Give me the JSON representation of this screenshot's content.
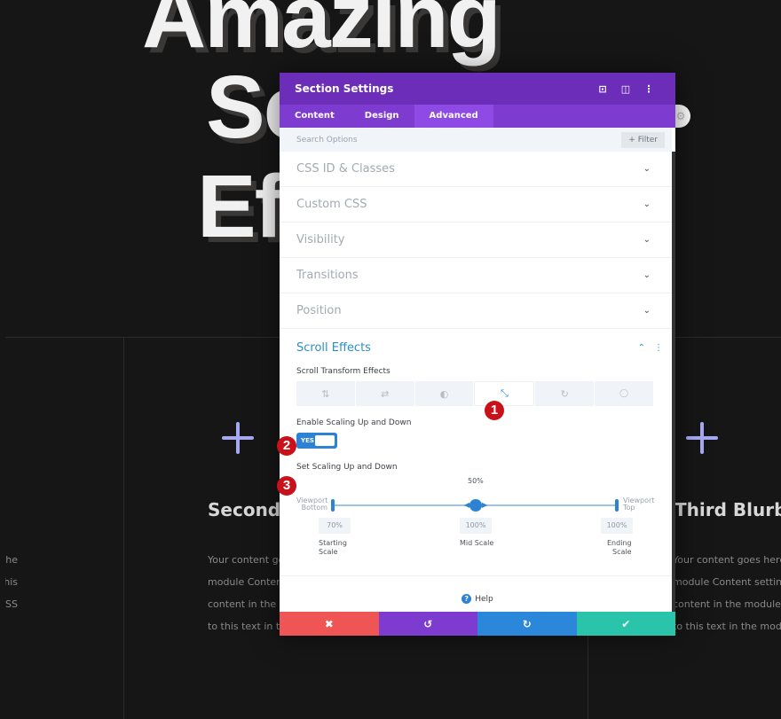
{
  "background": {
    "heading_lines": [
      "Amazing",
      "Sc",
      "Ef"
    ],
    "blurbs": [
      {
        "title": "",
        "text": [
          "the",
          "f this",
          "om CSS"
        ]
      },
      {
        "title": "Second",
        "text": [
          "Your content goe",
          "module Content",
          "content in the m",
          "to this text in the"
        ]
      },
      {
        "title": "Third Blurb",
        "text": [
          "Your content goes here. E",
          "module Content settings",
          "content in the module De",
          "to this text in the module"
        ]
      }
    ],
    "blurb_icon": "plus-icon",
    "accent": "#a7a8f2"
  },
  "modal": {
    "title": "Section Settings",
    "header_icons": [
      "focus-icon",
      "split-view-icon",
      "more-vertical-icon"
    ],
    "tabs": [
      {
        "label": "Content"
      },
      {
        "label": "Design"
      },
      {
        "label": "Advanced",
        "active": true
      }
    ],
    "search_placeholder": "Search Options",
    "filter_label": "+ Filter",
    "sections": [
      {
        "label": "CSS ID & Classes"
      },
      {
        "label": "Custom CSS"
      },
      {
        "label": "Visibility"
      },
      {
        "label": "Transitions"
      },
      {
        "label": "Position"
      }
    ],
    "scroll_effects": {
      "title": "Scroll Effects",
      "transform_label": "Scroll Transform Effects",
      "effects": [
        {
          "icon": "vertical-motion-icon",
          "glyph": "⇅"
        },
        {
          "icon": "horizontal-motion-icon",
          "glyph": "⇄"
        },
        {
          "icon": "fade-icon",
          "glyph": "◐"
        },
        {
          "icon": "scale-icon",
          "glyph": "⤡",
          "active": true
        },
        {
          "icon": "rotate-icon",
          "glyph": "↻"
        },
        {
          "icon": "blur-icon",
          "glyph": "💧"
        }
      ],
      "enable_label": "Enable Scaling Up and Down",
      "toggle_value": "YES",
      "set_label": "Set Scaling Up and Down",
      "slider": {
        "mid_percent": "50%",
        "left_label": [
          "Viewport",
          "Bottom"
        ],
        "right_label": [
          "Viewport",
          "Top"
        ],
        "starting_scale": "70%",
        "mid_scale": "100%",
        "ending_scale": "100%",
        "starting_caption": [
          "Starting",
          "Scale"
        ],
        "mid_caption": "Mid Scale",
        "ending_caption": [
          "Ending",
          "Scale"
        ]
      }
    },
    "help_label": "Help",
    "footer": {
      "cancel_color": "#ef5555",
      "undo_color": "#7e3bd0",
      "redo_color": "#2b87da",
      "save_color": "#29c4a9"
    }
  },
  "badges": [
    "1",
    "2",
    "3"
  ]
}
